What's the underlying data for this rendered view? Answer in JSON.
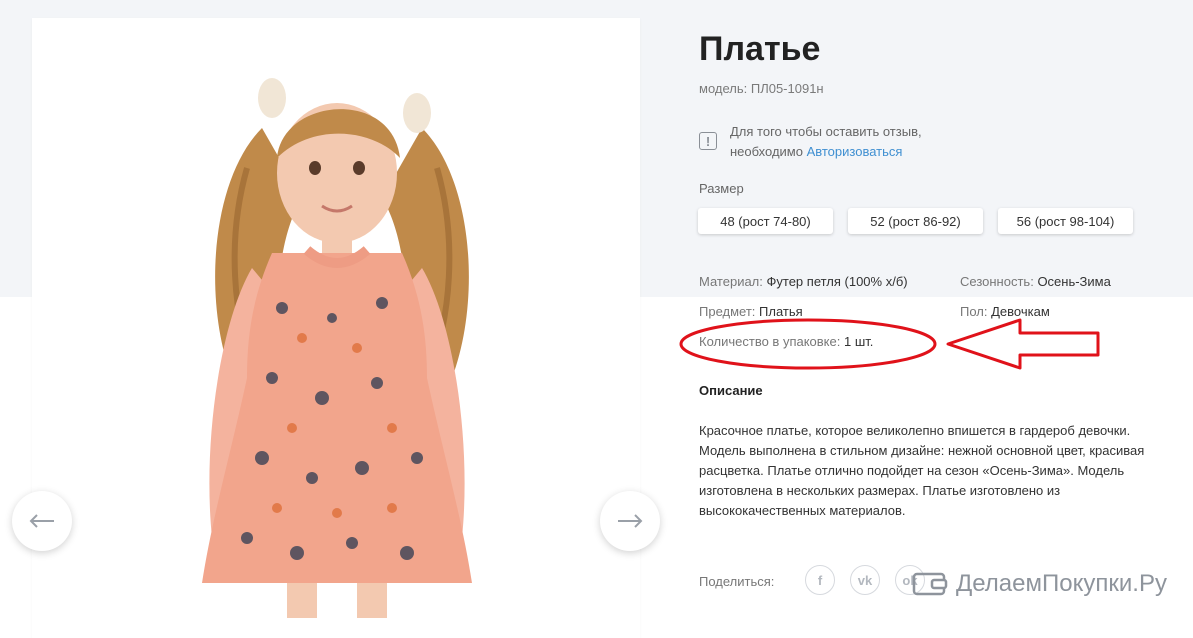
{
  "product": {
    "title": "Платье",
    "model": "модель: ПЛ05-1091н"
  },
  "review_notice": {
    "line1": "Для того чтобы оставить отзыв,",
    "line2_prefix": "необходимо ",
    "login_link": "Авторизоваться",
    "icon": "exclamation-icon"
  },
  "sizes": {
    "label": "Размер",
    "options": [
      "48 (рост 74-80)",
      "52 (рост 86-92)",
      "56 (рост 98-104)"
    ]
  },
  "properties": {
    "material": {
      "key": "Материал:",
      "value": "Футер петля (100% х/б)"
    },
    "season": {
      "key": "Сезонность:",
      "value": "Осень-Зима"
    },
    "subject": {
      "key": "Предмет:",
      "value": "Платья"
    },
    "gender": {
      "key": "Пол:",
      "value": "Девочкам"
    },
    "quantity": {
      "key": "Количество в упаковке:",
      "value": "1 шт."
    }
  },
  "description": {
    "title": "Описание",
    "text": "Красочное платье, которое великолепно впишется в гардероб девочки. Модель выполнена в стильном дизайне: нежной основной цвет, красивая расцветка. Платье отлично подойдет на сезон «Осень-Зима». Модель изготовлена в нескольких размерах. Платье изготовлено из высококачественных материалов."
  },
  "gallery": {
    "prev_icon": "arrow-left-icon",
    "next_icon": "arrow-right-icon"
  },
  "share": {
    "label": "Поделиться:",
    "networks": [
      "f",
      "vk",
      "ok"
    ]
  },
  "watermark": {
    "text": "ДелаемПокупки.Ру"
  },
  "colors": {
    "accent_link": "#3f8fd1",
    "annotation": "#e0121a",
    "band": "#f3f5f8",
    "dress": "#f2a58c"
  }
}
